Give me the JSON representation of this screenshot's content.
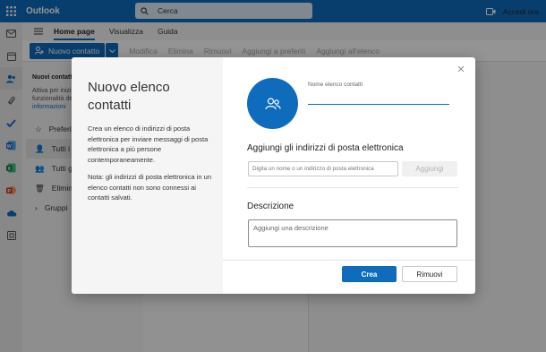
{
  "app": {
    "name": "Outlook"
  },
  "search": {
    "placeholder": "Cerca"
  },
  "header": {
    "signin_label": "Accedi ora"
  },
  "ribbon": {
    "tabs": [
      {
        "label": "Home page",
        "active": true
      },
      {
        "label": "Visualizza",
        "active": false
      },
      {
        "label": "Guida",
        "active": false
      }
    ],
    "new_contact_label": "Nuovo contatto",
    "items": [
      "Modifica",
      "Elimina",
      "Rimuovi",
      "Aggiungi a preferiti",
      "Aggiungi all'elenco"
    ]
  },
  "sidenav": {
    "title": "Nuovi contatti",
    "text": "Attiva per iniziare a usare le nuove funzionalità dei contatti.",
    "link": "Altre informazioni",
    "items": [
      "Preferiti",
      "Tutti i contatti",
      "Tutti gli elenchi contatti",
      "Eliminati",
      "Gruppi"
    ]
  },
  "dialog": {
    "title": "Nuovo elenco contatti",
    "description": "Crea un elenco di indirizzi di posta elettronica per inviare messaggi di posta elettronica a più persone contemporaneamente.",
    "note": "Nota: gli indirizzi di posta elettronica in un elenco contatti non sono connessi ai contatti salvati.",
    "name_label": "Nome elenco contatti",
    "name_value": "",
    "addresses_title": "Aggiungi gli indirizzi di posta elettronica",
    "address_placeholder": "Digita un nome o un indirizzo di posta elettronica",
    "add_label": "Aggiungi",
    "description_title": "Descrizione",
    "description_placeholder": "Aggiungi una descrizione",
    "create_label": "Crea",
    "remove_label": "Rimuovi"
  },
  "colors": {
    "brand": "#0f6cbd",
    "overlay": "rgba(0,0,0,0.42)"
  }
}
